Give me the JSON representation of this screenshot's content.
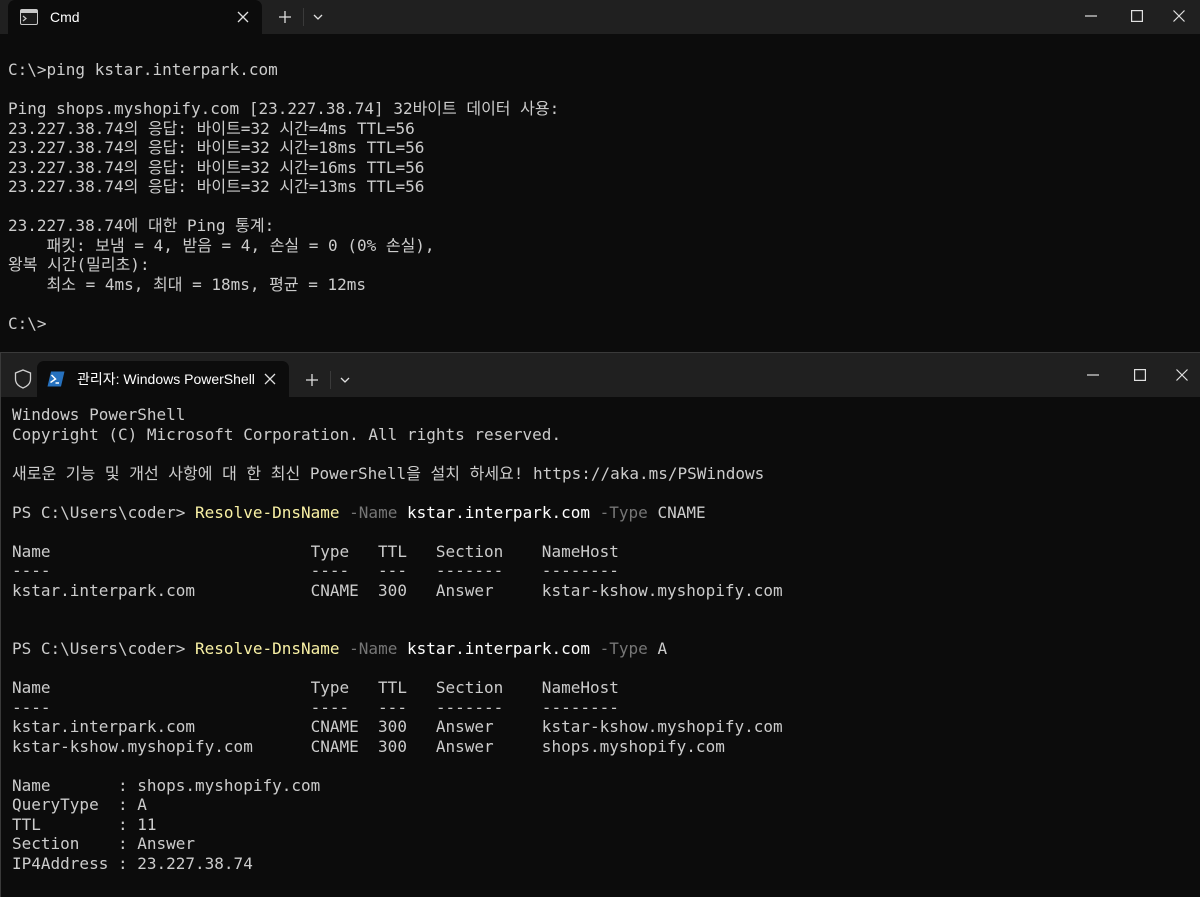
{
  "cmd_window": {
    "tab_title": "Cmd",
    "lines": [
      "C:\\>ping kstar.interpark.com",
      "",
      "Ping shops.myshopify.com [23.227.38.74] 32바이트 데이터 사용:",
      "23.227.38.74의 응답: 바이트=32 시간=4ms TTL=56",
      "23.227.38.74의 응답: 바이트=32 시간=18ms TTL=56",
      "23.227.38.74의 응답: 바이트=32 시간=16ms TTL=56",
      "23.227.38.74의 응답: 바이트=32 시간=13ms TTL=56",
      "",
      "23.227.38.74에 대한 Ping 통계:",
      "    패킷: 보냄 = 4, 받음 = 4, 손실 = 0 (0% 손실),",
      "왕복 시간(밀리초):",
      "    최소 = 4ms, 최대 = 18ms, 평균 = 12ms",
      "",
      "C:\\>"
    ]
  },
  "ps_window": {
    "tab_title": "관리자: Windows PowerShell",
    "banner": [
      "Windows PowerShell",
      "Copyright (C) Microsoft Corporation. All rights reserved.",
      "",
      "새로운 기능 및 개선 사항에 대 한 최신 PowerShell을 설치 하세요! https://aka.ms/PSWindows",
      ""
    ],
    "command1": {
      "prompt": "PS C:\\Users\\coder> ",
      "cmdlet": "Resolve-DnsName",
      "param_name": " -Name ",
      "name_value": "kstar.interpark.com",
      "param_type": " -Type ",
      "type_value": "CNAME"
    },
    "output1": [
      "",
      "Name                           Type   TTL   Section    NameHost",
      "----                           ----   ---   -------    --------",
      "kstar.interpark.com            CNAME  300   Answer     kstar-kshow.myshopify.com",
      "",
      ""
    ],
    "command2": {
      "prompt": "PS C:\\Users\\coder> ",
      "cmdlet": "Resolve-DnsName",
      "param_name": " -Name ",
      "name_value": "kstar.interpark.com",
      "param_type": " -Type ",
      "type_value": "A"
    },
    "output2": [
      "",
      "Name                           Type   TTL   Section    NameHost",
      "----                           ----   ---   -------    --------",
      "kstar.interpark.com            CNAME  300   Answer     kstar-kshow.myshopify.com",
      "kstar-kshow.myshopify.com      CNAME  300   Answer     shops.myshopify.com",
      "",
      "Name       : shops.myshopify.com",
      "QueryType  : A",
      "TTL        : 11",
      "Section    : Answer",
      "IP4Address : 23.227.38.74"
    ]
  },
  "icons": [
    "cmd-icon",
    "powershell-icon",
    "shield-icon",
    "close-icon",
    "plus-icon",
    "chevron-down-icon",
    "minimize-icon",
    "maximize-icon"
  ],
  "colors": {
    "background": "#0c0c0c",
    "titlebar": "#202020",
    "text": "#cccccc",
    "cmdlet": "#f9f1a5",
    "parameter": "#767676",
    "argument": "#ffffff"
  }
}
